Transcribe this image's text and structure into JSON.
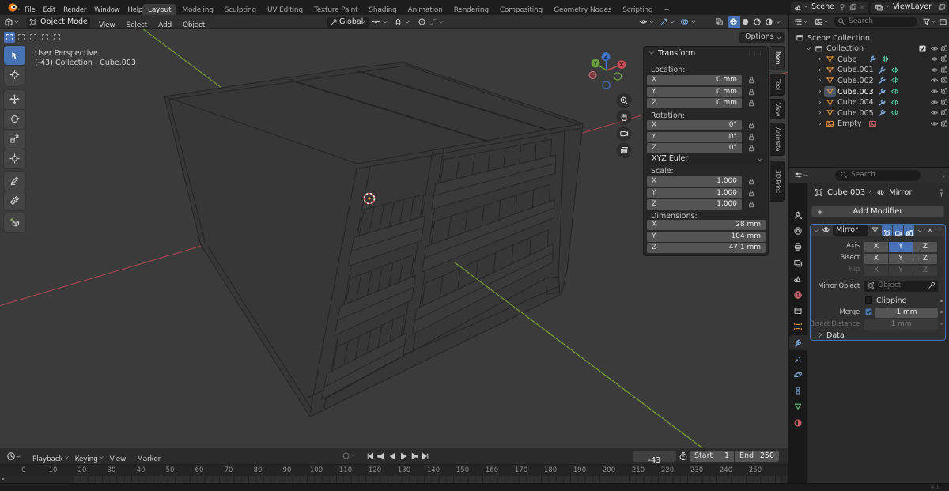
{
  "topbar": {
    "menus": [
      "File",
      "Edit",
      "Render",
      "Window",
      "Help"
    ],
    "workspaces": [
      "Layout",
      "Modeling",
      "Sculpting",
      "UV Editing",
      "Texture Paint",
      "Shading",
      "Animation",
      "Rendering",
      "Compositing",
      "Geometry Nodes",
      "Scripting"
    ],
    "active_workspace": "Layout",
    "workspace_add": "+",
    "scene_label": "Scene",
    "viewlayer_label": "ViewLayer"
  },
  "viewport_header": {
    "mode": "Object Mode",
    "menus": [
      "View",
      "Select",
      "Add",
      "Object"
    ],
    "orientation": "Global",
    "options_label": "Options"
  },
  "viewport": {
    "overlay_line1": "User Perspective",
    "overlay_line2": "(-43) Collection | Cube.003",
    "axis_x_color": "#a8484f",
    "axis_y_color": "#7a9d35",
    "gizmo_labels": {
      "x": "X",
      "y": "Y",
      "z": "Z"
    }
  },
  "toolbar_tools": [
    "select-box",
    "cursor",
    "move",
    "rotate",
    "scale",
    "transform",
    "annotate",
    "measure",
    "add-cube"
  ],
  "npanel": {
    "title": "Transform",
    "groups": [
      {
        "label": "Location:",
        "rows": [
          {
            "k": "X",
            "v": "0 mm"
          },
          {
            "k": "Y",
            "v": "0 mm"
          },
          {
            "k": "Z",
            "v": "0 mm"
          }
        ],
        "locks": true
      },
      {
        "label": "Rotation:",
        "rows": [
          {
            "k": "X",
            "v": "0°"
          },
          {
            "k": "Y",
            "v": "0°"
          },
          {
            "k": "Z",
            "v": "0°"
          }
        ],
        "locks": true
      },
      {
        "label": "Scale:",
        "rows": [
          {
            "k": "X",
            "v": "1.000"
          },
          {
            "k": "Y",
            "v": "1.000"
          },
          {
            "k": "Z",
            "v": "1.000"
          }
        ],
        "locks": true
      },
      {
        "label": "Dimensions:",
        "rows": [
          {
            "k": "X",
            "v": "28 mm"
          },
          {
            "k": "Y",
            "v": "104 mm"
          },
          {
            "k": "Z",
            "v": "47.1 mm"
          }
        ],
        "locks": false
      }
    ],
    "euler_mode": "XYZ Euler",
    "tabs": [
      "Item",
      "Tool",
      "View",
      "Animate",
      "3D Print"
    ],
    "active_tab": "Item"
  },
  "outliner": {
    "search_placeholder": "Search",
    "items": [
      {
        "label": "Scene Collection",
        "icon": "scenecoll",
        "depth": 0,
        "arrow": null
      },
      {
        "label": "Collection",
        "icon": "collection",
        "depth": 1,
        "arrow": "down",
        "checkbox": true,
        "eye": true,
        "cam": true
      },
      {
        "label": "Cube",
        "icon": "mesh",
        "depth": 2,
        "arrow": "right",
        "mods": true,
        "modx": 1096,
        "eye": true,
        "cam": true
      },
      {
        "label": "Cube.001",
        "icon": "mesh",
        "depth": 2,
        "arrow": "right",
        "mods": true,
        "modx": 1108,
        "eye": true,
        "cam": true
      },
      {
        "label": "Cube.002",
        "icon": "mesh",
        "depth": 2,
        "arrow": "right",
        "mods": true,
        "modx": 1108,
        "eye": true,
        "cam": true
      },
      {
        "label": "Cube.003",
        "icon": "mesh",
        "depth": 2,
        "arrow": "right",
        "mods": true,
        "modx": 1108,
        "selected": true,
        "eye": true,
        "cam": true
      },
      {
        "label": "Cube.004",
        "icon": "mesh",
        "depth": 2,
        "arrow": "right",
        "mods": true,
        "modx": 1108,
        "eye": true,
        "cam": true
      },
      {
        "label": "Cube.005",
        "icon": "mesh",
        "depth": 2,
        "arrow": "right",
        "mods": true,
        "modx": 1108,
        "eye": true,
        "cam": true
      },
      {
        "label": "Empty",
        "icon": "imgobj",
        "depth": 2,
        "arrow": "right",
        "extra": "imgred",
        "eye": true,
        "cam": true
      }
    ]
  },
  "properties": {
    "search_placeholder": "Search",
    "breadcrumb_object": "Cube.003",
    "breadcrumb_modifier": "Mirror",
    "add_modifier_label": "Add Modifier",
    "tabs": [
      "tool",
      "render",
      "output",
      "viewlayer",
      "scene",
      "world",
      "collection",
      "object",
      "modifier",
      "particles",
      "physics",
      "constraints",
      "data",
      "material"
    ],
    "active_tab": "modifier",
    "modifier": {
      "name": "Mirror",
      "axis_label": "Axis",
      "bisect_label": "Bisect",
      "flip_label": "Flip",
      "axes": [
        "X",
        "Y",
        "Z"
      ],
      "axis_active": "Y",
      "mirror_object_label": "Mirror Object",
      "mirror_object_placeholder": "Object",
      "clipping_label": "Clipping",
      "merge_label": "Merge",
      "merge_value": "1 mm",
      "bisect_distance_label": "Bisect Distance",
      "bisect_distance_value": "1 mm",
      "data_label": "Data"
    }
  },
  "timeline": {
    "menus": [
      "Playback",
      "Keying",
      "View",
      "Marker"
    ],
    "current_frame": "-43",
    "start_label": "Start",
    "start_value": "1",
    "end_label": "End",
    "end_value": "250",
    "ruler_labels": [
      0,
      10,
      20,
      30,
      40,
      50,
      60,
      70,
      80,
      90,
      100,
      110,
      120,
      130,
      140,
      150,
      160,
      170,
      180,
      190,
      200,
      210,
      220,
      230,
      240,
      250
    ]
  },
  "statusbar": {
    "version": "4.1"
  }
}
